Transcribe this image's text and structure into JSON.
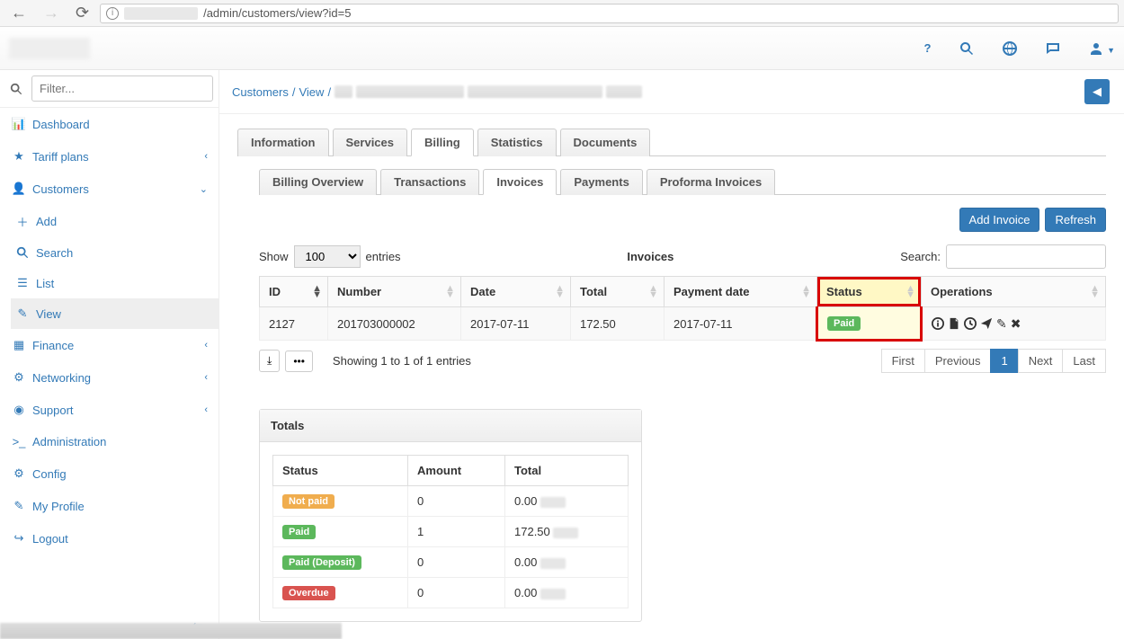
{
  "browser": {
    "url_path": "/admin/customers/view?id=5"
  },
  "header_icons": [
    "help",
    "search",
    "globe",
    "message",
    "user"
  ],
  "sidebar": {
    "filter_placeholder": "Filter...",
    "items": [
      {
        "label": "Dashboard"
      },
      {
        "label": "Tariff plans",
        "caret": "left"
      },
      {
        "label": "Customers",
        "caret": "down"
      },
      {
        "label": "Add",
        "sub": true
      },
      {
        "label": "Search",
        "sub": true
      },
      {
        "label": "List",
        "sub": true
      },
      {
        "label": "View",
        "sub": true,
        "active": true
      },
      {
        "label": "Finance",
        "caret": "left"
      },
      {
        "label": "Networking",
        "caret": "left"
      },
      {
        "label": "Support",
        "caret": "left"
      },
      {
        "label": "Administration"
      },
      {
        "label": "Config"
      },
      {
        "label": "My Profile"
      },
      {
        "label": "Logout"
      }
    ]
  },
  "breadcrumb": {
    "parts": [
      "Customers",
      "View"
    ]
  },
  "tabs": {
    "top": [
      "Information",
      "Services",
      "Billing",
      "Statistics",
      "Documents"
    ],
    "top_active": 2,
    "sub": [
      "Billing Overview",
      "Transactions",
      "Invoices",
      "Payments",
      "Proforma Invoices"
    ],
    "sub_active": 2
  },
  "actions": {
    "add_invoice": "Add Invoice",
    "refresh": "Refresh"
  },
  "table": {
    "title": "Invoices",
    "show_label": "Show",
    "show_value": "100",
    "entries_label": "entries",
    "search_label": "Search:",
    "columns": [
      "ID",
      "Number",
      "Date",
      "Total",
      "Payment date",
      "Status",
      "Operations"
    ],
    "rows": [
      {
        "id": "2127",
        "number": "201703000002",
        "date": "2017-07-11",
        "total": "172.50",
        "payment_date": "2017-07-11",
        "status": "Paid",
        "status_class": "green"
      }
    ],
    "footer_info": "Showing 1 to 1 of 1 entries",
    "pagination": [
      "First",
      "Previous",
      "1",
      "Next",
      "Last"
    ],
    "pagination_active": 2
  },
  "totals": {
    "title": "Totals",
    "columns": [
      "Status",
      "Amount",
      "Total"
    ],
    "rows": [
      {
        "status": "Not paid",
        "status_class": "orange",
        "amount": "0",
        "total": "0.00"
      },
      {
        "status": "Paid",
        "status_class": "green",
        "amount": "1",
        "total": "172.50"
      },
      {
        "status": "Paid (Deposit)",
        "status_class": "green",
        "amount": "0",
        "total": "0.00"
      },
      {
        "status": "Overdue",
        "status_class": "red",
        "amount": "0",
        "total": "0.00"
      }
    ]
  }
}
